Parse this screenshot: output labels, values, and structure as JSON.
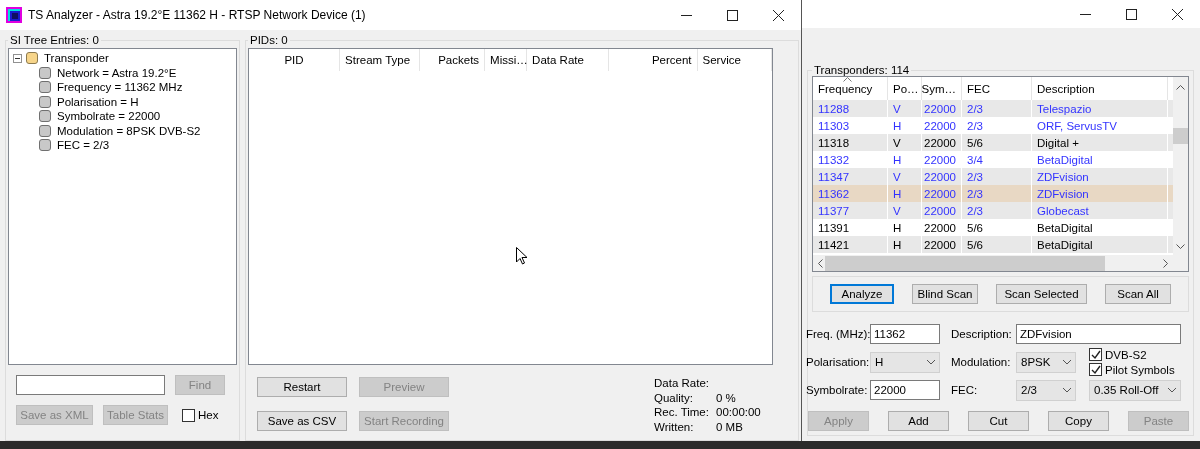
{
  "main_window": {
    "title": "TS Analyzer - Astra 19.2°E 11362 H - RTSP Network Device (1)",
    "si_tree": {
      "heading": "SI Tree Entries: 0",
      "nodes": [
        {
          "label": "Transponder",
          "kind": "folder",
          "expanded": true,
          "children": [
            {
              "label": "Network = Astra 19.2°E",
              "kind": "item"
            },
            {
              "label": "Frequency = 11362 MHz",
              "kind": "item"
            },
            {
              "label": "Polarisation = H",
              "kind": "item"
            },
            {
              "label": "Symbolrate = 22000",
              "kind": "item"
            },
            {
              "label": "Modulation = 8PSK DVB-S2",
              "kind": "item"
            },
            {
              "label": "FEC = 2/3",
              "kind": "item"
            }
          ]
        }
      ]
    },
    "tree_buttons": [
      {
        "label": "Find",
        "disabled": true
      },
      {
        "label": "Save as XML",
        "disabled": true
      },
      {
        "label": "Table Stats",
        "disabled": true
      }
    ],
    "hex_checkbox": {
      "label": "Hex",
      "checked": false
    },
    "pids": {
      "heading": "PIDs: 0",
      "columns": [
        "PID",
        "Stream Type",
        "Packets",
        "Missi…",
        "Data Rate",
        "Percent",
        "Service"
      ]
    },
    "pid_buttons": [
      {
        "label": "Restart",
        "disabled": false
      },
      {
        "label": "Preview",
        "disabled": true
      },
      {
        "label": "Save as CSV",
        "disabled": false
      },
      {
        "label": "Start Recording",
        "disabled": true
      }
    ],
    "stats": [
      {
        "label": "Data Rate:"
      },
      {
        "label": "Quality:",
        "value": "0 %"
      },
      {
        "label": "Rec. Time:",
        "value": "00:00:00"
      },
      {
        "label": "Written:",
        "value": "0 MB"
      }
    ]
  },
  "scan_window": {
    "transponders": {
      "heading": "Transponders: 114",
      "columns": [
        {
          "label": "Frequency",
          "sorted": true
        },
        {
          "label": "Po…",
          "sorted": false
        },
        {
          "label": "Sym…",
          "sorted": false
        },
        {
          "label": "FEC",
          "sorted": false
        },
        {
          "label": "Description",
          "sorted": false
        }
      ],
      "rows": [
        {
          "cells": [
            "11288",
            "V",
            "22000",
            "2/3",
            "Telespazio"
          ],
          "color": "#3333ff",
          "selected": false
        },
        {
          "cells": [
            "11303",
            "H",
            "22000",
            "2/3",
            "ORF, ServusTV"
          ],
          "color": "#3333ff",
          "selected": false
        },
        {
          "cells": [
            "11318",
            "V",
            "22000",
            "5/6",
            "Digital +"
          ],
          "color": "#000000",
          "selected": false
        },
        {
          "cells": [
            "11332",
            "H",
            "22000",
            "3/4",
            "BetaDigital"
          ],
          "color": "#3333ff",
          "selected": false
        },
        {
          "cells": [
            "11347",
            "V",
            "22000",
            "2/3",
            "ZDFvision"
          ],
          "color": "#3333ff",
          "selected": false
        },
        {
          "cells": [
            "11362",
            "H",
            "22000",
            "2/3",
            "ZDFvision"
          ],
          "color": "#3333ff",
          "selected": true
        },
        {
          "cells": [
            "11377",
            "V",
            "22000",
            "2/3",
            "Globecast"
          ],
          "color": "#3333ff",
          "selected": false
        },
        {
          "cells": [
            "11391",
            "H",
            "22000",
            "5/6",
            "BetaDigital"
          ],
          "color": "#000000",
          "selected": false
        },
        {
          "cells": [
            "11421",
            "H",
            "22000",
            "5/6",
            "BetaDigital"
          ],
          "color": "#000000",
          "selected": false
        }
      ]
    },
    "scan_buttons": [
      {
        "label": "Analyze",
        "focused": true
      },
      {
        "label": "Blind Scan",
        "focused": false
      },
      {
        "label": "Scan Selected",
        "focused": false
      },
      {
        "label": "Scan All",
        "focused": false
      }
    ],
    "form": {
      "frequency": {
        "label": "Freq. (MHz):",
        "value": "11362"
      },
      "description": {
        "label": "Description:",
        "value": "ZDFvision"
      },
      "polarisation": {
        "label": "Polarisation:",
        "value": "H"
      },
      "modulation": {
        "label": "Modulation:",
        "value": "8PSK"
      },
      "dvb_s2": {
        "label": "DVB-S2",
        "checked": true
      },
      "pilot_symbols": {
        "label": "Pilot Symbols",
        "checked": true
      },
      "symbolrate": {
        "label": "Symbolrate:",
        "value": "22000"
      },
      "fec": {
        "label": "FEC:",
        "value": "2/3"
      },
      "roll_off": {
        "value": "0.35 Roll-Off"
      }
    },
    "bottom_buttons": [
      {
        "label": "Apply",
        "disabled": true
      },
      {
        "label": "Add",
        "disabled": false
      },
      {
        "label": "Cut",
        "disabled": false
      },
      {
        "label": "Copy",
        "disabled": false
      },
      {
        "label": "Paste",
        "disabled": true
      }
    ]
  }
}
